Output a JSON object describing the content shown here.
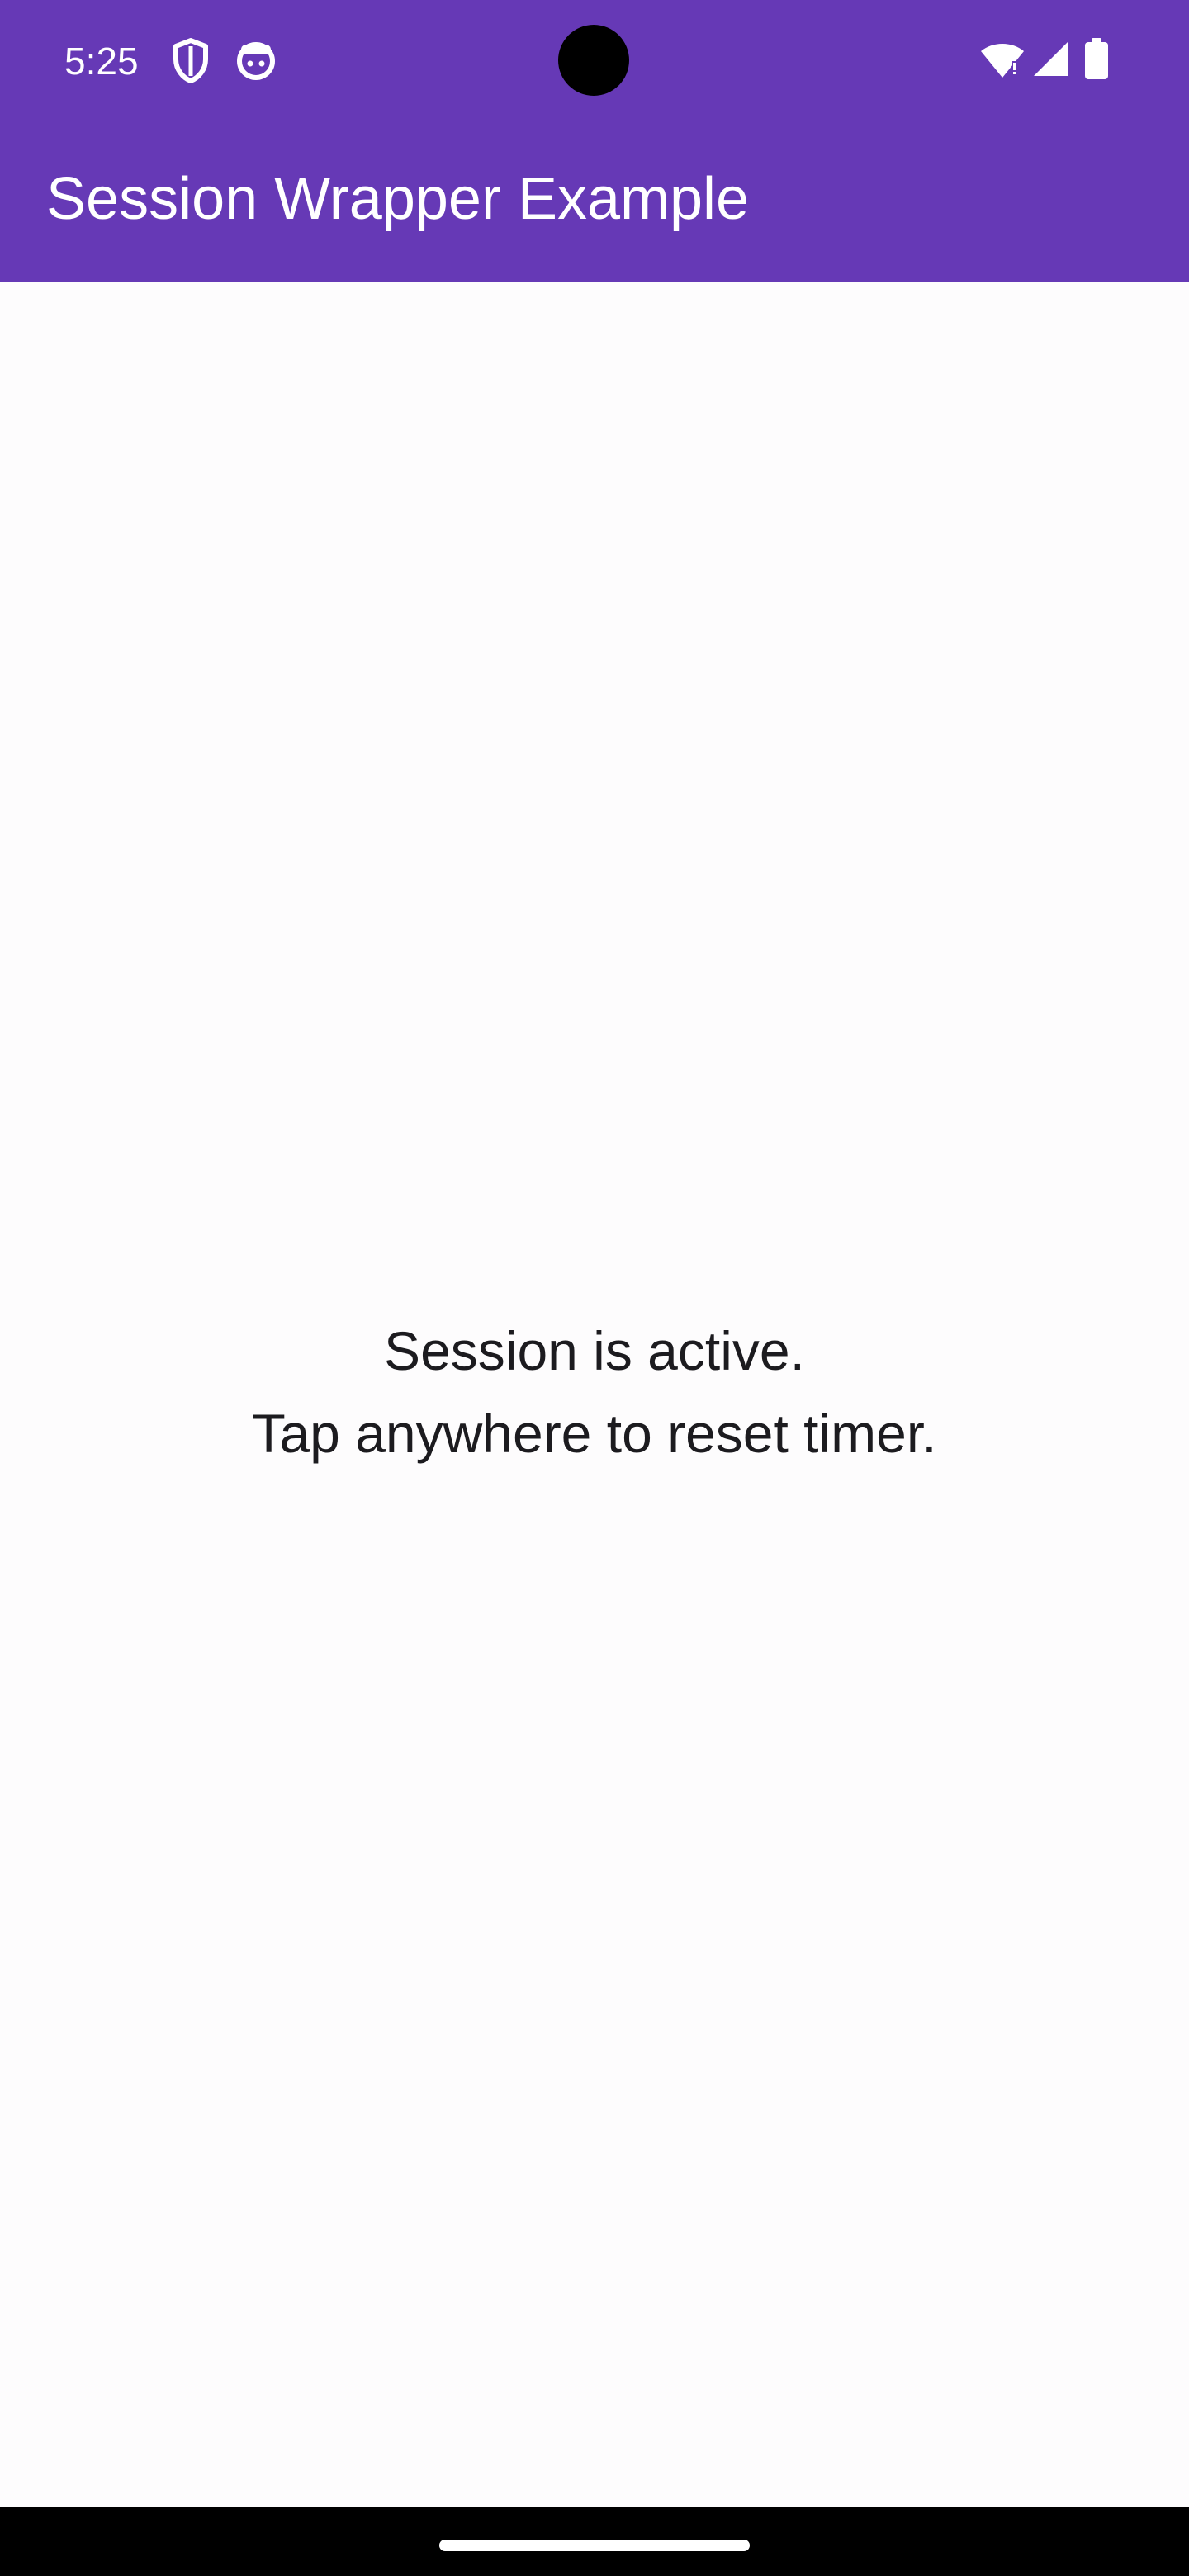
{
  "status_bar": {
    "time": "5:25",
    "left_icons": [
      "shield-icon",
      "android-face-icon"
    ],
    "right_icons": [
      "wifi-icon",
      "signal-icon",
      "battery-icon"
    ]
  },
  "app_bar": {
    "title": "Session Wrapper Example",
    "color": "#6639b6"
  },
  "main": {
    "line1": "Session is active.",
    "line2": "Tap anywhere to reset timer."
  },
  "colors": {
    "background": "#fdfcfd",
    "text": "#1c1b1f"
  }
}
